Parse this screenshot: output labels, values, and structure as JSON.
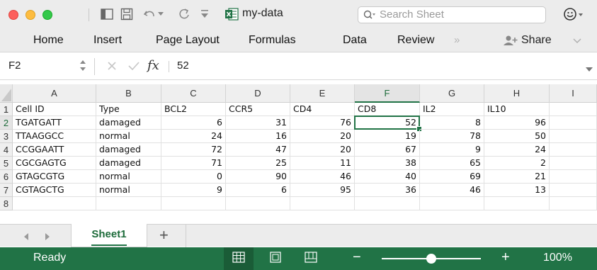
{
  "window": {
    "title": "my-data",
    "search_placeholder": "Search Sheet",
    "share_label": "Share",
    "chevron_label": "»"
  },
  "ribbon": {
    "tabs": [
      "Home",
      "Insert",
      "Page Layout",
      "Formulas",
      "Data",
      "Review"
    ]
  },
  "formula_bar": {
    "name_box": "F2",
    "fx_label": "fx",
    "value": "52"
  },
  "sheet": {
    "columns": [
      "A",
      "B",
      "C",
      "D",
      "E",
      "F",
      "G",
      "H",
      "I"
    ],
    "row_numbers": [
      "1",
      "2",
      "3",
      "4",
      "5",
      "6",
      "7",
      "8"
    ],
    "header_row": [
      "Cell ID",
      "Type",
      "BCL2",
      "CCR5",
      "CD4",
      "CD8",
      "IL2",
      "IL10",
      ""
    ],
    "data_rows": [
      [
        "TGATGATT",
        "damaged",
        "6",
        "31",
        "76",
        "52",
        "8",
        "96",
        ""
      ],
      [
        "TTAAGGCC",
        "normal",
        "24",
        "16",
        "20",
        "19",
        "78",
        "50",
        ""
      ],
      [
        "CCGGAATT",
        "damaged",
        "72",
        "47",
        "20",
        "67",
        "9",
        "24",
        ""
      ],
      [
        "CGCGAGTG",
        "damaged",
        "71",
        "25",
        "11",
        "38",
        "65",
        "2",
        ""
      ],
      [
        "GTAGCGTG",
        "normal",
        "0",
        "90",
        "46",
        "40",
        "69",
        "21",
        ""
      ],
      [
        "CGTAGCTG",
        "normal",
        "9",
        "6",
        "95",
        "36",
        "46",
        "13",
        ""
      ]
    ],
    "selected_cell": "F2",
    "active_sheet": "Sheet1",
    "add_sheet_label": "+"
  },
  "status_bar": {
    "ready_label": "Ready",
    "zoom_minus": "−",
    "zoom_plus": "+",
    "zoom_level": "100%",
    "zoom_fraction": 0.5
  },
  "colors": {
    "accent": "#217346",
    "light_red": "#fc605c",
    "light_yellow": "#fdbc40",
    "light_green": "#34c84a"
  }
}
